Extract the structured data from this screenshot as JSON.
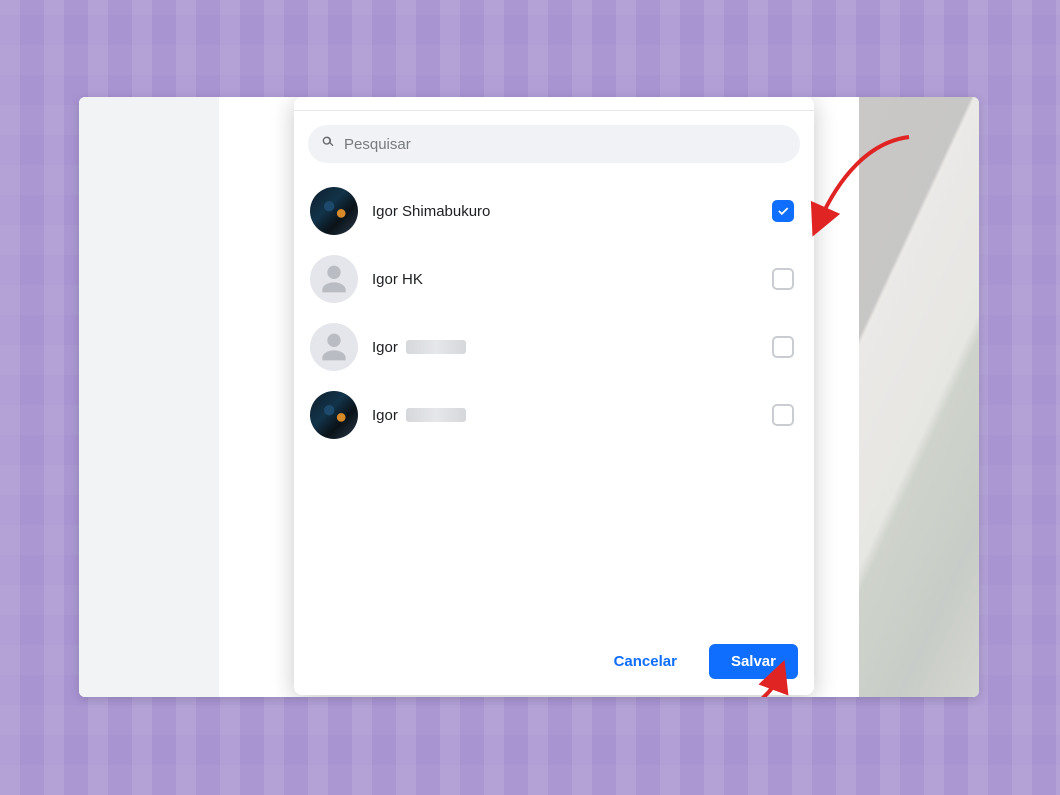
{
  "colors": {
    "accent": "#0f6efd",
    "frame_bg": "#a894d1",
    "surface": "#ffffff",
    "muted_bg": "#f0f2f5",
    "text": "#1c1e21",
    "text_muted": "#65676b",
    "annotation": "#e02424"
  },
  "search": {
    "placeholder": "Pesquisar",
    "value": ""
  },
  "people": [
    {
      "name": "Igor Shimabukuro",
      "has_photo": true,
      "checked": true,
      "partially_hidden": false
    },
    {
      "name": "Igor HK",
      "has_photo": false,
      "checked": false,
      "partially_hidden": false
    },
    {
      "name": "Igor",
      "has_photo": false,
      "checked": false,
      "partially_hidden": true
    },
    {
      "name": "Igor",
      "has_photo": true,
      "checked": false,
      "partially_hidden": true
    }
  ],
  "footer": {
    "cancel_label": "Cancelar",
    "save_label": "Salvar"
  },
  "annotations": {
    "arrow_to_checkbox": true,
    "arrow_to_save": true
  }
}
